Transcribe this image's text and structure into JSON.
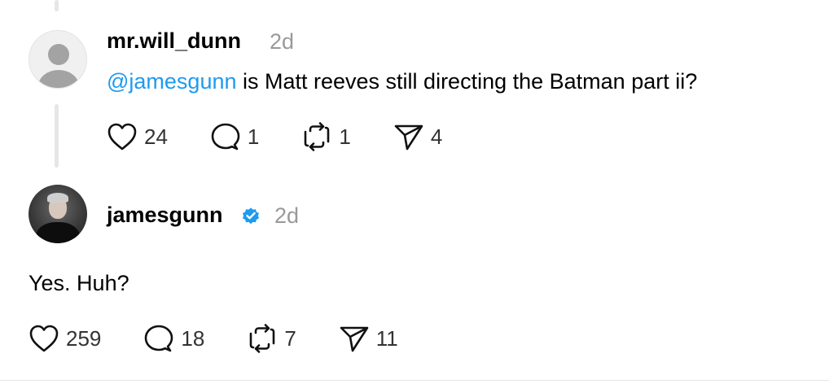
{
  "reply": {
    "username": "mr.will_dunn",
    "time": "2d",
    "mention": "@jamesgunn",
    "text": " is Matt reeves still directing the Batman part ii?",
    "likes": "24",
    "replies": "1",
    "reposts": "1",
    "shares": "4"
  },
  "response": {
    "username": "jamesgunn",
    "verified": true,
    "time": "2d",
    "text": "Yes. Huh?",
    "likes": "259",
    "replies": "18",
    "reposts": "7",
    "shares": "11"
  },
  "icons": {
    "like": "heart-icon",
    "reply": "speech-bubble-icon",
    "repost": "repost-icon",
    "share": "paper-plane-icon",
    "verified": "verified-badge-icon"
  },
  "colors": {
    "mention": "#1d9bf0",
    "verified": "#1d9bf0",
    "timestamp": "#999999",
    "thread_line": "#e6e6e6"
  }
}
